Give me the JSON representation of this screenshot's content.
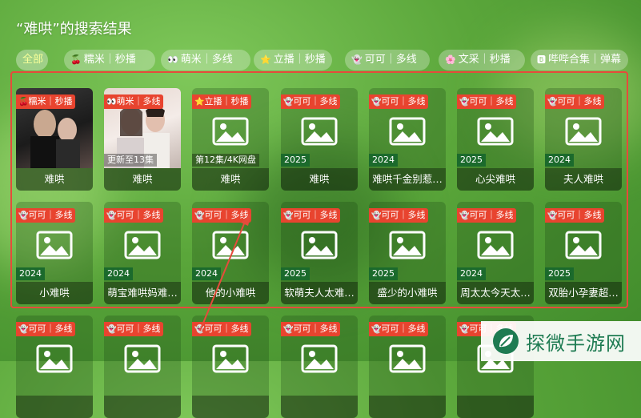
{
  "page_title": "“难哄”的搜索结果",
  "filters": [
    {
      "label": "全部",
      "icon": "",
      "active": true
    },
    {
      "label": "糯米｜秒播",
      "icon": "🍒",
      "active": false
    },
    {
      "label": "萌米｜多线",
      "icon": "👀",
      "active": false
    },
    {
      "label": "立播｜秒播",
      "icon": "⭐",
      "active": false
    },
    {
      "label": "可可｜多线",
      "icon": "👻",
      "active": false
    },
    {
      "label": "文采｜秒播",
      "icon": "🌸",
      "active": false
    },
    {
      "label": "哔哔合集｜弹幕",
      "icon": "🅱",
      "active": false
    }
  ],
  "results": [
    {
      "source": "糯米｜秒播",
      "source_icon": "🍒",
      "title": "难哄",
      "year": "",
      "poster": "photo-dark"
    },
    {
      "source": "萌米｜多线",
      "source_icon": "👀",
      "title": "难哄",
      "year": "更新至13集",
      "poster": "photo-light"
    },
    {
      "source": "立播｜秒播",
      "source_icon": "⭐",
      "title": "难哄",
      "year": "第12集/4K网盘",
      "poster": "placeholder"
    },
    {
      "source": "可可｜多线",
      "source_icon": "👻",
      "title": "难哄",
      "year": "2025",
      "poster": "placeholder"
    },
    {
      "source": "可可｜多线",
      "source_icon": "👻",
      "title": "难哄千金别惹…",
      "year": "2024",
      "poster": "placeholder"
    },
    {
      "source": "可可｜多线",
      "source_icon": "👻",
      "title": "心尖难哄",
      "year": "2025",
      "poster": "placeholder"
    },
    {
      "source": "可可｜多线",
      "source_icon": "👻",
      "title": "夫人难哄",
      "year": "2024",
      "poster": "placeholder"
    },
    {
      "source": "可可｜多线",
      "source_icon": "👻",
      "title": "小难哄",
      "year": "2024",
      "poster": "placeholder"
    },
    {
      "source": "可可｜多线",
      "source_icon": "👻",
      "title": "萌宝难哄妈难…",
      "year": "2024",
      "poster": "placeholder"
    },
    {
      "source": "可可｜多线",
      "source_icon": "👻",
      "title": "他的小难哄",
      "year": "2024",
      "poster": "placeholder"
    },
    {
      "source": "可可｜多线",
      "source_icon": "👻",
      "title": "软萌夫人太难…",
      "year": "2025",
      "poster": "placeholder"
    },
    {
      "source": "可可｜多线",
      "source_icon": "👻",
      "title": "盛少的小难哄",
      "year": "2025",
      "poster": "placeholder"
    },
    {
      "source": "可可｜多线",
      "source_icon": "👻",
      "title": "周太太今天太…",
      "year": "2024",
      "poster": "placeholder"
    },
    {
      "source": "可可｜多线",
      "source_icon": "👻",
      "title": "双胎小孕妻超…",
      "year": "2025",
      "poster": "placeholder"
    },
    {
      "source": "可可｜多线",
      "source_icon": "👻",
      "title": "",
      "year": "",
      "poster": "placeholder"
    },
    {
      "source": "可可｜多线",
      "source_icon": "👻",
      "title": "",
      "year": "",
      "poster": "placeholder"
    },
    {
      "source": "可可｜多线",
      "source_icon": "👻",
      "title": "",
      "year": "",
      "poster": "placeholder"
    },
    {
      "source": "可可｜多线",
      "source_icon": "👻",
      "title": "",
      "year": "",
      "poster": "placeholder"
    },
    {
      "source": "可可｜多线",
      "source_icon": "👻",
      "title": "",
      "year": "",
      "poster": "placeholder"
    },
    {
      "source": "可可｜多线",
      "source_icon": "👻",
      "title": "",
      "year": "",
      "poster": "placeholder"
    }
  ],
  "watermark": {
    "text": "探微手游网",
    "icon": "leaf-logo-icon"
  },
  "colors": {
    "badge": "#e8442f",
    "year_tag": "#1b6a2c",
    "highlight": "#e64b3b",
    "active_tab_text": "#f8ff9a"
  }
}
